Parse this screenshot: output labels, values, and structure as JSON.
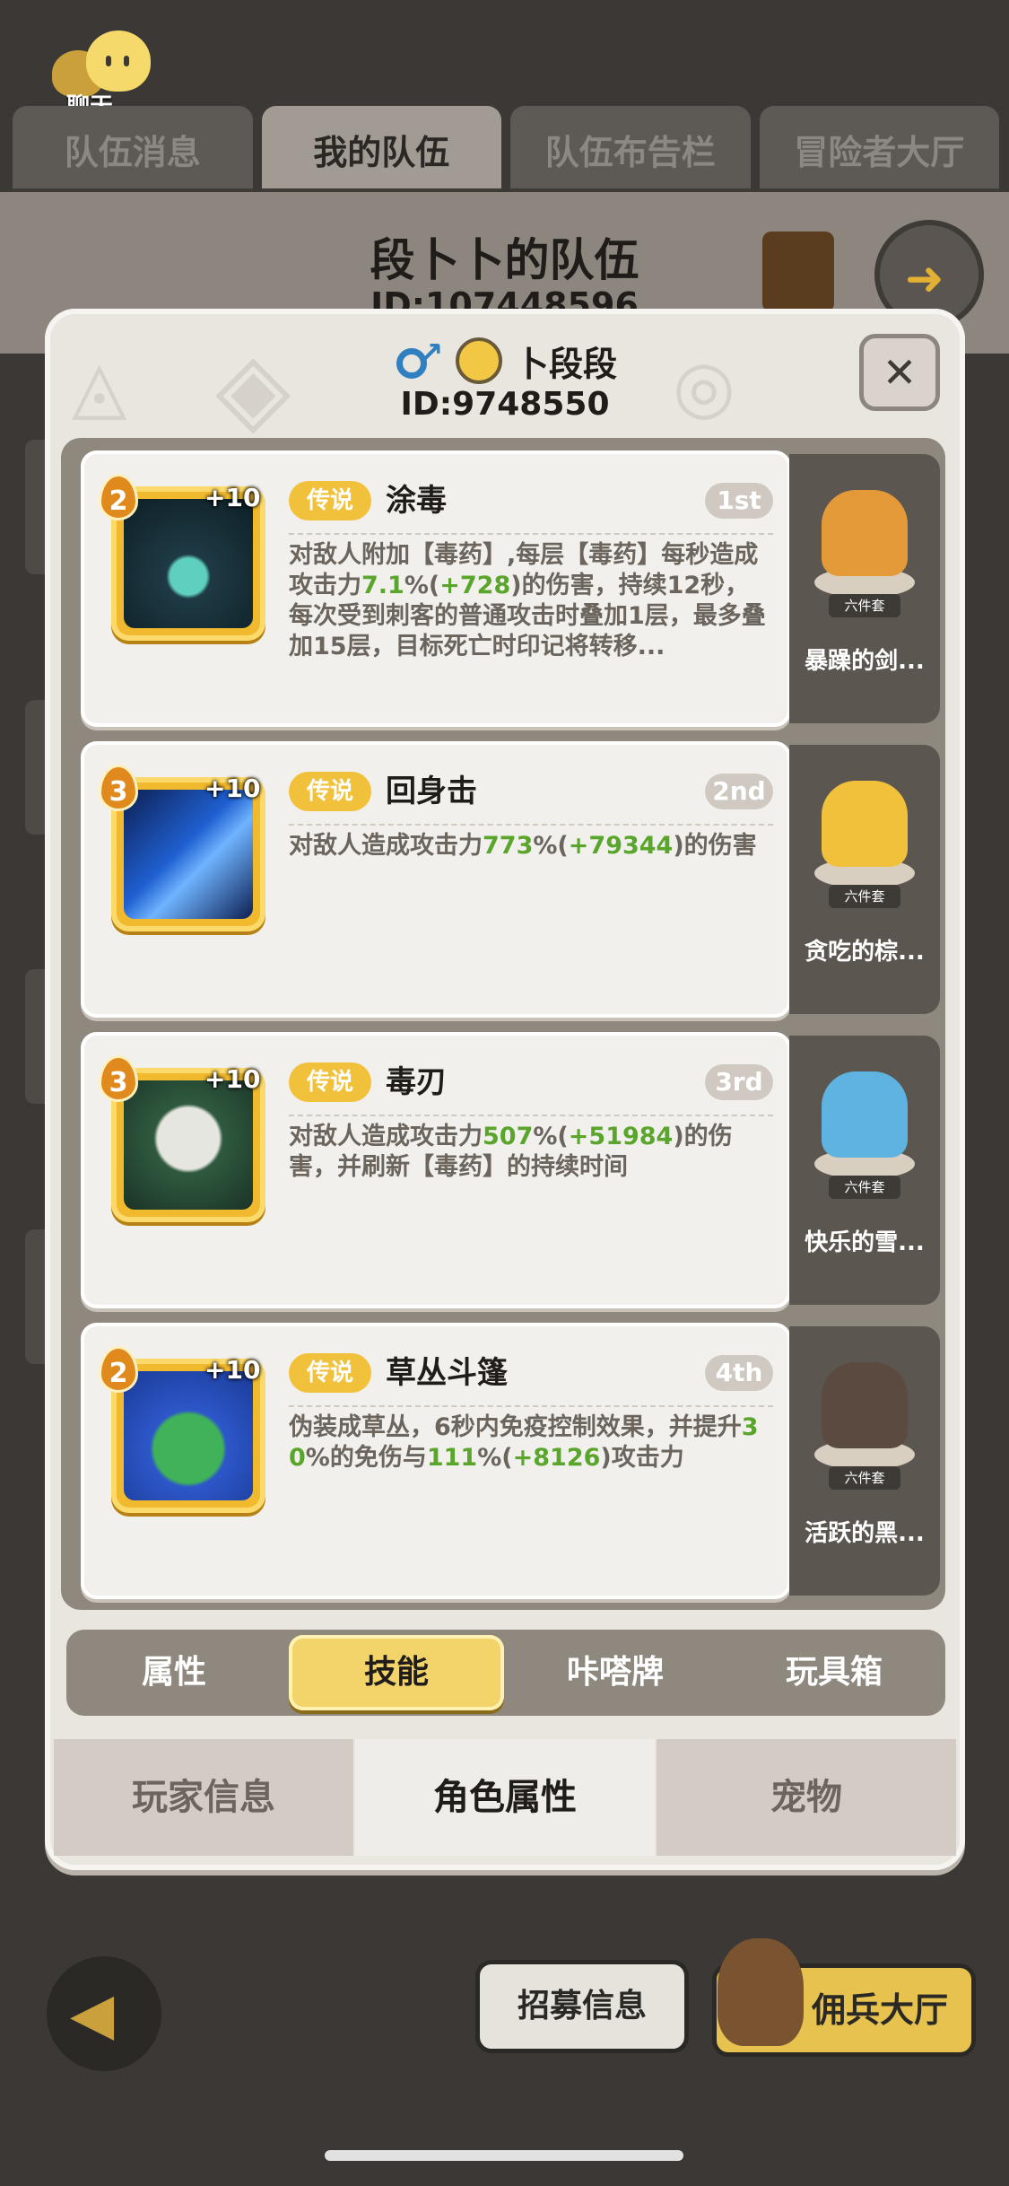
{
  "chat": {
    "label": "聊天"
  },
  "top_tabs": [
    "队伍消息",
    "我的队伍",
    "队伍布告栏",
    "冒险者大厅"
  ],
  "team": {
    "title": "段卜卜的队伍",
    "id": "ID:107448596"
  },
  "player": {
    "name": "卜段段",
    "id": "ID:9748550",
    "gender": "male"
  },
  "skills": [
    {
      "level": "2",
      "plus": "+10",
      "rarity": "传说",
      "name": "涂毒",
      "rank": "1st",
      "desc_parts": [
        {
          "t": "对敌人附加【毒药】,每层【毒药】每秒造成攻击力"
        },
        {
          "t": "7.1",
          "g": true
        },
        {
          "t": "%("
        },
        {
          "t": "+728",
          "g": true
        },
        {
          "t": ")的伤害，持续12秒，每次受到刺客的普通攻击时叠加1层，最多叠加15层，目标死亡时印记将转移..."
        }
      ],
      "char_name": "暴躁的剑...",
      "char_badge": "六件套",
      "icon_color": "#1e3a44",
      "char_color": "#e59a3a"
    },
    {
      "level": "3",
      "plus": "+10",
      "rarity": "传说",
      "name": "回身击",
      "rank": "2nd",
      "desc_parts": [
        {
          "t": "对敌人造成攻击力"
        },
        {
          "t": "773",
          "g": true
        },
        {
          "t": "%("
        },
        {
          "t": "+79344",
          "g": true
        },
        {
          "t": ")的伤害"
        }
      ],
      "char_name": "贪吃的棕...",
      "char_badge": "六件套",
      "icon_color": "#163a7a",
      "char_color": "#f2c13b"
    },
    {
      "level": "3",
      "plus": "+10",
      "rarity": "传说",
      "name": "毒刃",
      "rank": "3rd",
      "desc_parts": [
        {
          "t": "对敌人造成攻击力"
        },
        {
          "t": "507",
          "g": true
        },
        {
          "t": "%("
        },
        {
          "t": "+51984",
          "g": true
        },
        {
          "t": ")的伤害，并刷新【毒药】的持续时间"
        }
      ],
      "char_name": "快乐的雪...",
      "char_badge": "六件套",
      "icon_color": "#2f5a3f",
      "char_color": "#5fb3e0"
    },
    {
      "level": "2",
      "plus": "+10",
      "rarity": "传说",
      "name": "草丛斗篷",
      "rank": "4th",
      "desc_parts": [
        {
          "t": "伪装成草丛，6秒内免疫控制效果，并提升"
        },
        {
          "t": "30",
          "g": true
        },
        {
          "t": "%的免伤与"
        },
        {
          "t": "111",
          "g": true
        },
        {
          "t": "%("
        },
        {
          "t": "+8126",
          "g": true
        },
        {
          "t": ")攻击力"
        }
      ],
      "char_name": "活跃的黑...",
      "char_badge": "六件套",
      "icon_color": "#2d57c9",
      "char_color": "#5a4a40"
    }
  ],
  "sub_tabs": [
    "属性",
    "技能",
    "咔嗒牌",
    "玩具箱"
  ],
  "sub_tab_active": 1,
  "bottom_tabs": [
    "玩家信息",
    "角色属性",
    "宠物"
  ],
  "bottom_tab_active": 1,
  "footer": {
    "recruit": "招募信息",
    "mercenary": "佣兵大厅"
  },
  "colors": {
    "accent": "#f2c13b",
    "green": "#5aa52b",
    "panel": "#8f887f"
  }
}
